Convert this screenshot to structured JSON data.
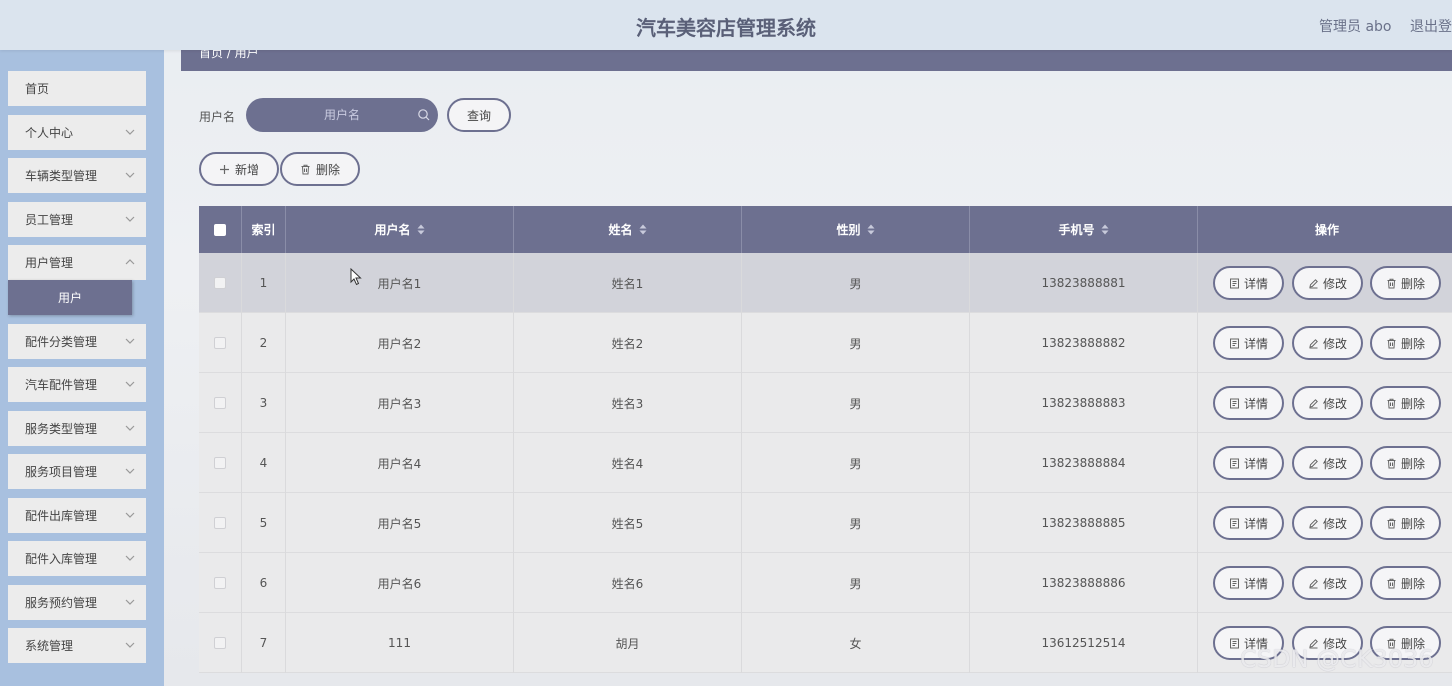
{
  "header": {
    "title": "汽车美容店管理系统",
    "user": "管理员 abo",
    "logout": "退出登录"
  },
  "sidebar": {
    "items": [
      {
        "label": "首页",
        "has_children": false
      },
      {
        "label": "个人中心",
        "has_children": true
      },
      {
        "label": "车辆类型管理",
        "has_children": true
      },
      {
        "label": "员工管理",
        "has_children": true
      },
      {
        "label": "用户管理",
        "has_children": true
      },
      {
        "label": "配件分类管理",
        "has_children": true
      },
      {
        "label": "汽车配件管理",
        "has_children": true
      },
      {
        "label": "服务类型管理",
        "has_children": true
      },
      {
        "label": "服务项目管理",
        "has_children": true
      },
      {
        "label": "配件出库管理",
        "has_children": true
      },
      {
        "label": "配件入库管理",
        "has_children": true
      },
      {
        "label": "服务预约管理",
        "has_children": true
      },
      {
        "label": "系统管理",
        "has_children": true
      }
    ],
    "active_sub": "用户"
  },
  "breadcrumb": "首页 / 用户",
  "search": {
    "label": "用户名",
    "placeholder": "用户名",
    "query_button": "查询"
  },
  "actions": {
    "add": "新增",
    "delete": "删除"
  },
  "table": {
    "columns": [
      "索引",
      "用户名",
      "姓名",
      "性别",
      "手机号",
      "操作"
    ],
    "rows": [
      {
        "index": "1",
        "username": "用户名1",
        "name": "姓名1",
        "gender": "男",
        "phone": "13823888881"
      },
      {
        "index": "2",
        "username": "用户名2",
        "name": "姓名2",
        "gender": "男",
        "phone": "13823888882"
      },
      {
        "index": "3",
        "username": "用户名3",
        "name": "姓名3",
        "gender": "男",
        "phone": "13823888883"
      },
      {
        "index": "4",
        "username": "用户名4",
        "name": "姓名4",
        "gender": "男",
        "phone": "13823888884"
      },
      {
        "index": "5",
        "username": "用户名5",
        "name": "姓名5",
        "gender": "男",
        "phone": "13823888885"
      },
      {
        "index": "6",
        "username": "用户名6",
        "name": "姓名6",
        "gender": "男",
        "phone": "13823888886"
      },
      {
        "index": "7",
        "username": "111",
        "name": "胡月",
        "gender": "女",
        "phone": "13612512514"
      }
    ],
    "row_actions": {
      "detail": "详情",
      "edit": "修改",
      "delete": "删除"
    }
  },
  "watermark": "CSDN @CK3036",
  "colors": {
    "accent": "#6d7090",
    "sidebar": "#a8c0df",
    "header": "#dbe4ee"
  }
}
